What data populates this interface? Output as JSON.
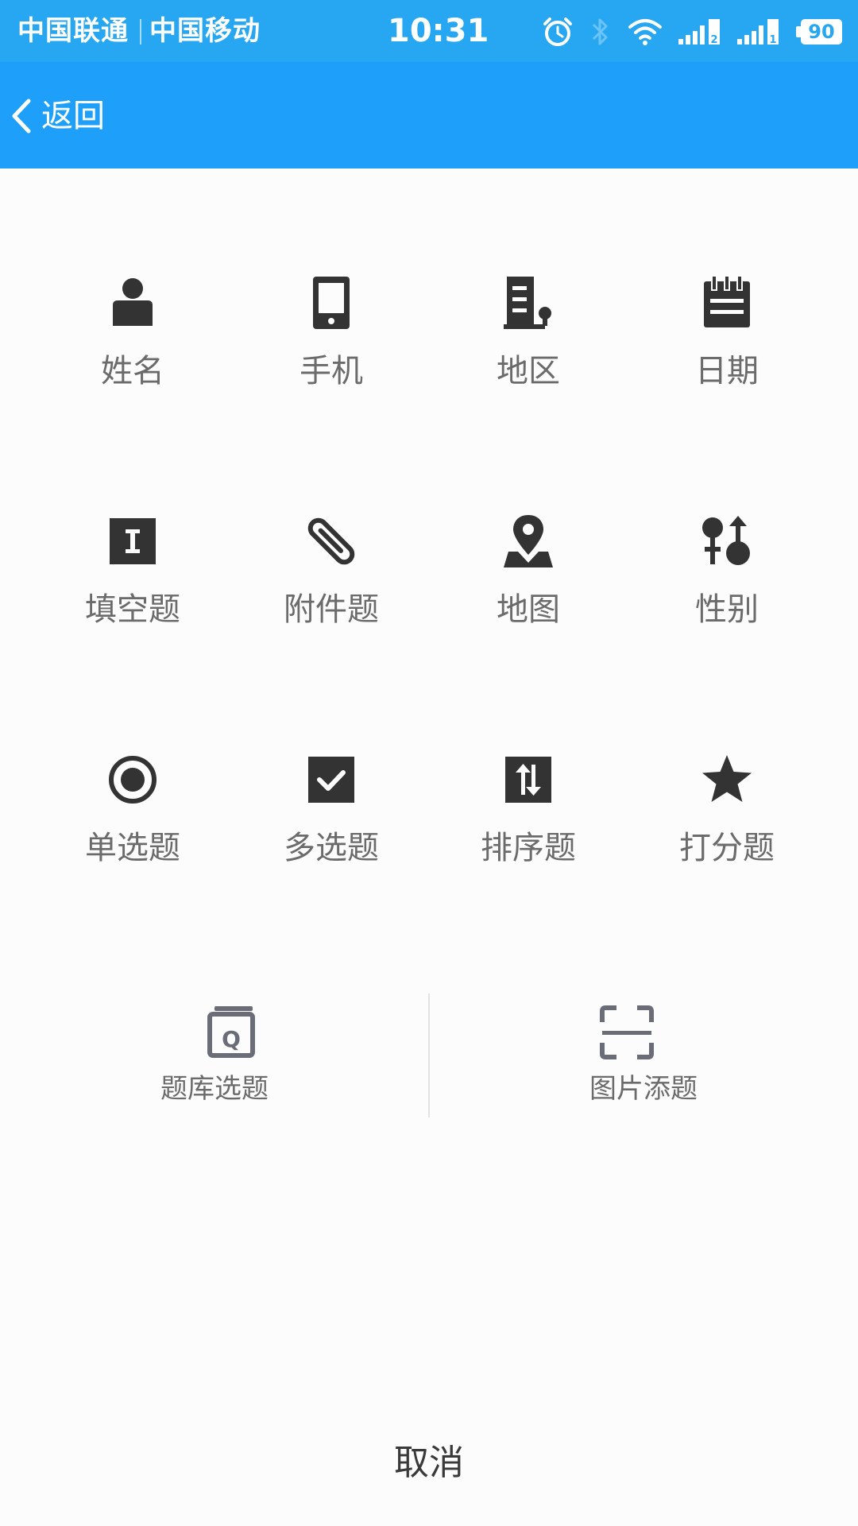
{
  "status_bar": {
    "carrier_1": "中国联通",
    "carrier_2": "中国移动",
    "time": "10:31",
    "battery_level": "90",
    "sim1_label": "2",
    "sim2_label": "1",
    "icons": [
      "alarm-icon",
      "bluetooth-icon",
      "wifi-icon",
      "signal-icon",
      "signal-icon",
      "battery-icon"
    ]
  },
  "nav": {
    "back_label": "返回"
  },
  "question_types": [
    {
      "label": "姓名",
      "icon": "person-icon"
    },
    {
      "label": "手机",
      "icon": "phone-icon"
    },
    {
      "label": "地区",
      "icon": "building-icon"
    },
    {
      "label": "日期",
      "icon": "calendar-icon"
    },
    {
      "label": "填空题",
      "icon": "text-box-icon"
    },
    {
      "label": "附件题",
      "icon": "paperclip-icon"
    },
    {
      "label": "地图",
      "icon": "map-pin-icon"
    },
    {
      "label": "性别",
      "icon": "gender-icon"
    },
    {
      "label": "单选题",
      "icon": "radio-icon"
    },
    {
      "label": "多选题",
      "icon": "checkbox-icon"
    },
    {
      "label": "排序题",
      "icon": "sort-icon"
    },
    {
      "label": "打分题",
      "icon": "star-icon"
    }
  ],
  "actions": {
    "bank_label": "题库选题",
    "image_label": "图片添题"
  },
  "cancel_label": "取消",
  "colors": {
    "status_bar": "#27a6f1",
    "nav_bar": "#1e9ffa",
    "icon": "#333333",
    "label": "#6b6b6b"
  }
}
